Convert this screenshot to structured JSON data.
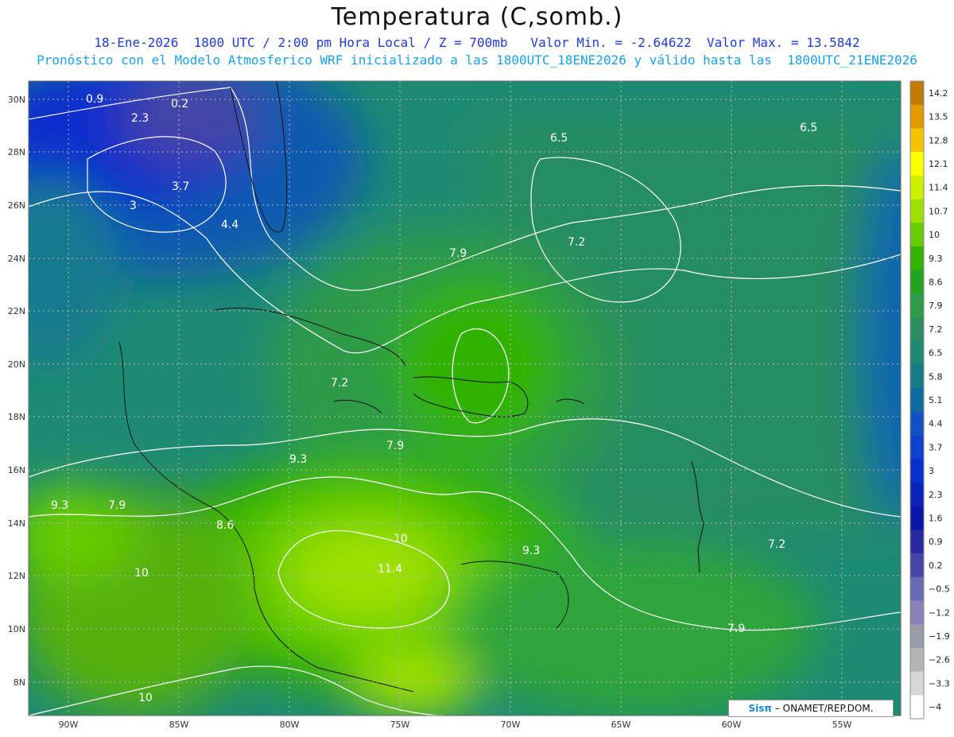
{
  "header": {
    "title": "Temperatura (C,somb.)",
    "line1": "18-Ene-2026  1800 UTC / 2:00 pm Hora Local / Z = 700mb   Valor Min. = -2.64622  Valor Max. = 13.5842",
    "line2": "Pronóstico con el Modelo Atmosferico WRF inicializado a las 1800UTC_18ENE2026 y válido hasta las  1800UTC_21ENE2026"
  },
  "axes": {
    "lon_labels": [
      "90W",
      "85W",
      "80W",
      "75W",
      "70W",
      "65W",
      "60W",
      "55W"
    ],
    "lat_labels": [
      "30N",
      "28N",
      "26N",
      "24N",
      "22N",
      "20N",
      "18N",
      "16N",
      "14N",
      "12N",
      "10N",
      "8N"
    ]
  },
  "colorbar": {
    "levels": [
      "14.2",
      "13.5",
      "12.8",
      "12.1",
      "11.4",
      "10.7",
      "10",
      "9.3",
      "8.6",
      "7.9",
      "7.2",
      "6.5",
      "5.8",
      "5.1",
      "4.4",
      "3.7",
      "3",
      "2.3",
      "1.6",
      "0.9",
      "0.2",
      "−0.5",
      "−1.2",
      "−1.9",
      "−2.6",
      "−3.3",
      "−4"
    ],
    "colors": [
      "#c07a00",
      "#e39a00",
      "#f5c400",
      "#ffff00",
      "#ccf000",
      "#9fe000",
      "#66cc00",
      "#33b200",
      "#22a422",
      "#2e9a4a",
      "#2a8e60",
      "#1e8a73",
      "#177b86",
      "#0f6a9e",
      "#1053c0",
      "#1040d0",
      "#0a2fcc",
      "#0b22b8",
      "#0a16a8",
      "#2a2aa0",
      "#4545a6",
      "#6a6ab0",
      "#8a80bb",
      "#9a9aa8",
      "#b4b4b4",
      "#d6d6d6",
      "#ffffff"
    ]
  },
  "contour_labels": [
    {
      "text": "0.9"
    },
    {
      "text": "0.2"
    },
    {
      "text": "2.3"
    },
    {
      "text": "3.7"
    },
    {
      "text": "3"
    },
    {
      "text": "4.4"
    },
    {
      "text": "6.5"
    },
    {
      "text": "6.5"
    },
    {
      "text": "7.2"
    },
    {
      "text": "7.9"
    },
    {
      "text": "7.2"
    },
    {
      "text": "7.9"
    },
    {
      "text": "9.3"
    },
    {
      "text": "9.3"
    },
    {
      "text": "7.9"
    },
    {
      "text": "8.6"
    },
    {
      "text": "10"
    },
    {
      "text": "11.4"
    },
    {
      "text": "10"
    },
    {
      "text": "9.3"
    },
    {
      "text": "7.2"
    },
    {
      "text": "7.9"
    },
    {
      "text": "10"
    }
  ],
  "credit": {
    "brand": "Sisπ",
    "org": "– ONAMET/REP.DOM."
  },
  "colors": {
    "title": "#111111",
    "line1": "#1f3bd6",
    "line2": "#1aa0ee",
    "contour": "#ffffff",
    "coast": "#111111"
  }
}
